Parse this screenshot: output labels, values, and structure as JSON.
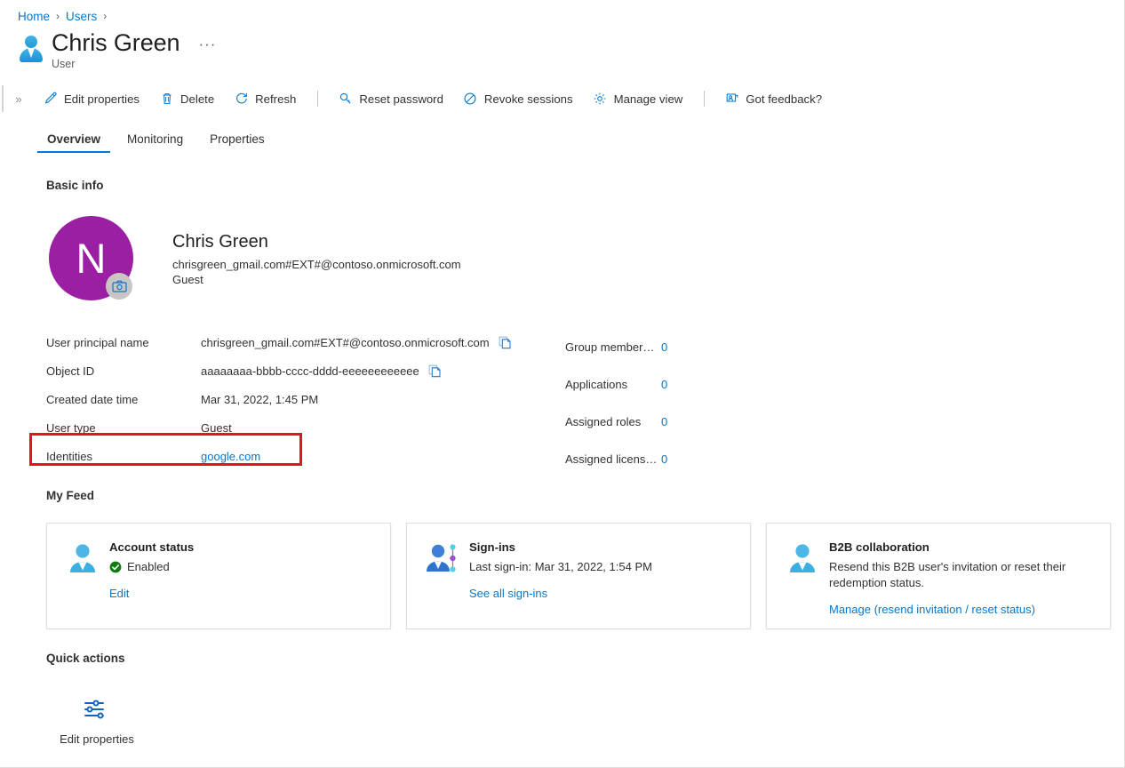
{
  "breadcrumb": {
    "items": [
      {
        "label": "Home"
      },
      {
        "label": "Users"
      }
    ],
    "separator": "›"
  },
  "header": {
    "title": "Chris Green",
    "subtitle": "User",
    "more_label": "···",
    "avatar_icon": "user-icon"
  },
  "toolbar": {
    "collapse_label": "»",
    "buttons": [
      {
        "label": "Edit properties",
        "icon": "pencil-icon"
      },
      {
        "label": "Delete",
        "icon": "trash-icon"
      },
      {
        "label": "Refresh",
        "icon": "refresh-icon"
      },
      {
        "label": "Reset password",
        "icon": "key-icon"
      },
      {
        "label": "Revoke sessions",
        "icon": "block-icon"
      },
      {
        "label": "Manage view",
        "icon": "gear-icon"
      },
      {
        "label": "Got feedback?",
        "icon": "feedback-icon"
      }
    ]
  },
  "tabs": [
    {
      "label": "Overview",
      "active": true
    },
    {
      "label": "Monitoring",
      "active": false
    },
    {
      "label": "Properties",
      "active": false
    }
  ],
  "sections": {
    "basic_info": "Basic info",
    "my_feed": "My Feed",
    "quick_actions": "Quick actions"
  },
  "profile": {
    "initial": "N",
    "avatar_color": "#9b1fa2",
    "camera_icon": "camera-icon",
    "name": "Chris Green",
    "upn": "chrisgreen_gmail.com#EXT#@contoso.onmicrosoft.com",
    "user_type": "Guest"
  },
  "properties_left": [
    {
      "label": "User principal name",
      "value": "chrisgreen_gmail.com#EXT#@contoso.onmicrosoft.com",
      "copy": true,
      "link": false
    },
    {
      "label": "Object ID",
      "value": "aaaaaaaa-bbbb-cccc-dddd-eeeeeeeeeeee",
      "copy": true,
      "link": false
    },
    {
      "label": "Created date time",
      "value": "Mar 31, 2022, 1:45 PM",
      "copy": false,
      "link": false
    },
    {
      "label": "User type",
      "value": "Guest",
      "copy": false,
      "link": false
    },
    {
      "label": "Identities",
      "value": "google.com",
      "copy": false,
      "link": true
    }
  ],
  "properties_right": [
    {
      "label": "Group member…",
      "count": "0"
    },
    {
      "label": "Applications",
      "count": "0"
    },
    {
      "label": "Assigned roles",
      "count": "0"
    },
    {
      "label": "Assigned licens…",
      "count": "0"
    }
  ],
  "highlight": {
    "color": "#e81123",
    "target": "Identities"
  },
  "feed_cards": [
    {
      "icon": "user-status-icon",
      "title": "Account status",
      "status_text": "Enabled",
      "status_color": "#107c10",
      "description": "",
      "link": "Edit"
    },
    {
      "icon": "signin-activity-icon",
      "title": "Sign-ins",
      "status_text": "",
      "status_color": "",
      "description": "Last sign-in: Mar 31, 2022, 1:54 PM",
      "link": "See all sign-ins"
    },
    {
      "icon": "b2b-user-icon",
      "title": "B2B collaboration",
      "status_text": "",
      "status_color": "",
      "description": "Resend this B2B user's invitation or reset their redemption status.",
      "link": "Manage (resend invitation / reset status)"
    }
  ],
  "quick_action_items": [
    {
      "label": "Edit properties",
      "icon": "sliders-icon"
    }
  ],
  "colors": {
    "accent": "#0078d4",
    "text": "#323130",
    "title": "#201f1e",
    "muted": "#605e5c",
    "border": "#e1dfdd",
    "avatar": "#9b1fa2",
    "success": "#107c10",
    "highlight": "#e81123"
  }
}
